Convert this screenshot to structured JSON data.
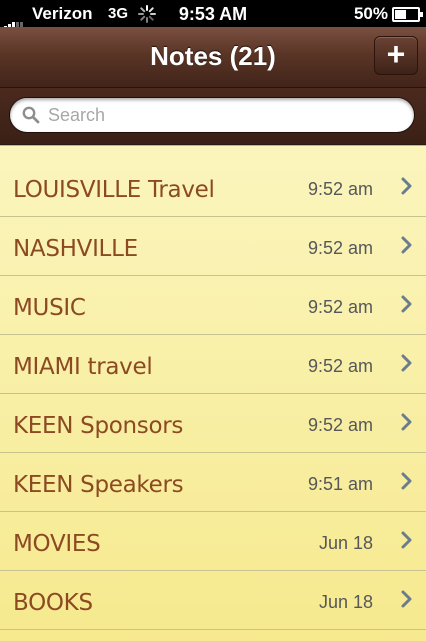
{
  "status_bar": {
    "carrier": "Verizon",
    "network": "3G",
    "time": "9:53 AM",
    "battery_percent": "50%",
    "battery_level": 0.5
  },
  "nav": {
    "title": "Notes (21)",
    "add_label": "+"
  },
  "search": {
    "placeholder": "Search"
  },
  "notes": [
    {
      "title": "LOUISVILLE Travel",
      "time": "9:52 am"
    },
    {
      "title": "NASHVILLE",
      "time": "9:52 am"
    },
    {
      "title": "MUSIC",
      "time": "9:52 am"
    },
    {
      "title": "MIAMI travel",
      "time": "9:52 am"
    },
    {
      "title": "KEEN Sponsors",
      "time": "9:52 am"
    },
    {
      "title": "KEEN Speakers",
      "time": "9:51 am"
    },
    {
      "title": "MOVIES",
      "time": "Jun 18"
    },
    {
      "title": "BOOKS",
      "time": "Jun 18"
    }
  ],
  "colors": {
    "note_title": "#8b4a22",
    "paper": "#f7ec97",
    "leather": "#5a3526"
  }
}
